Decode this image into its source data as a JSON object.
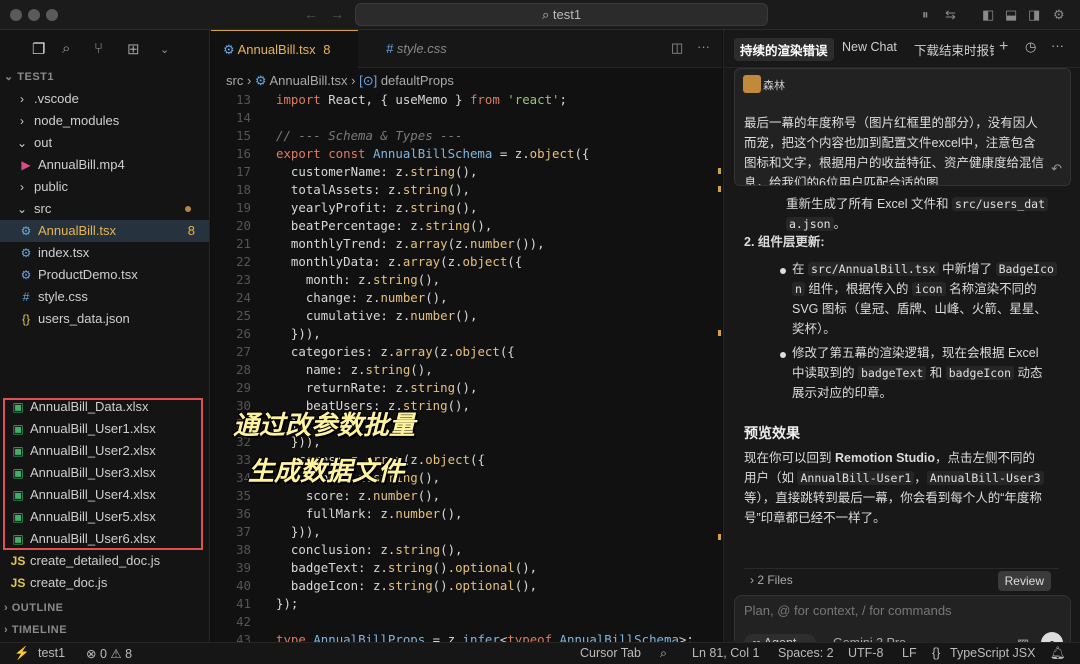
{
  "window": {
    "title": "test1"
  },
  "titlebar_icons": [
    "sidebar-left-icon",
    "panel-bottom-icon",
    "sidebar-right-icon",
    "gear-icon",
    "account-icon"
  ],
  "sidebar": {
    "root": "TEST1",
    "items": [
      {
        "label": ".vscode",
        "icon": "chevron-right"
      },
      {
        "label": "node_modules",
        "icon": "chevron-right"
      },
      {
        "label": "out",
        "icon": "chevron-down"
      },
      {
        "label": "AnnualBill.mp4",
        "icon": "video"
      },
      {
        "label": "public",
        "icon": "chevron-right"
      },
      {
        "label": "src",
        "icon": "chevron-down"
      },
      {
        "label": "AnnualBill.tsx",
        "icon": "gear",
        "badge": "8"
      },
      {
        "label": "index.tsx",
        "icon": "gear"
      },
      {
        "label": "ProductDemo.tsx",
        "icon": "gear"
      },
      {
        "label": "style.css",
        "icon": "hash"
      },
      {
        "label": "users_data.json",
        "icon": "braces"
      }
    ],
    "xlsx_files": [
      "AnnualBill_Data.xlsx",
      "AnnualBill_User1.xlsx",
      "AnnualBill_User2.xlsx",
      "AnnualBill_User3.xlsx",
      "AnnualBill_User4.xlsx",
      "AnnualBill_User5.xlsx",
      "AnnualBill_User6.xlsx"
    ],
    "js_files": [
      "create_detailed_doc.js",
      "create_doc.js"
    ],
    "outline": "OUTLINE",
    "timeline": "TIMELINE"
  },
  "editor": {
    "tabs": [
      {
        "label": "AnnualBill.tsx",
        "badge": "8"
      },
      {
        "label": "style.css"
      }
    ],
    "breadcrumb": {
      "folder": "src",
      "file": "AnnualBill.tsx",
      "symbol": "defaultProps"
    },
    "overlay_line1": "通过改参数批量",
    "overlay_line2": "生成数据文件"
  },
  "chat": {
    "tabs": [
      "持续的渲染错误",
      "New Chat",
      "下载结束时报错"
    ],
    "user_name": "森林",
    "user_message": "最后一幕的年度称号（图片红框里的部分），没有因人而宠，把这个内容也加到配置文件excel中，注意包含图标和文字，根据用户的收益特征、资产健康度给混信息，给我们的6位用户匹配合适的图",
    "partial_line_a": "重新生成了所有 Excel 文件和 ",
    "partial_code_a": "src/users_dat",
    "partial_code_a2": "a.json",
    "partial_line_a_end": "。",
    "section2_title": "2. 组件层更新:",
    "bullet1_pre": "在 ",
    "bullet1_code1": "src/AnnualBill.tsx",
    "bullet1_mid": " 中新增了 ",
    "bullet1_code2": "BadgeIco",
    "bullet1_code2b": "n",
    "bullet1_rest1": " 组件，根据传入的 ",
    "bullet1_code3": "icon",
    "bullet1_rest2": " 名称渲染不同的",
    "bullet1_rest3": "SVG 图标（皇冠、盾牌、山峰、火箭、星星、",
    "bullet1_rest4": "奖杯）。",
    "bullet2_line1": "修改了第五幕的渲染逻辑，现在会根据 Excel",
    "bullet2_pre": "中读取到的 ",
    "bullet2_code1": "badgeText",
    "bullet2_and": " 和 ",
    "bullet2_code2": "badgeIcon",
    "bullet2_end": " 动态",
    "bullet2_line3": "展示对应的印章。",
    "preview_title": "预览效果",
    "preview_p1": "现在你可以回到 ",
    "preview_bold": "Remotion Studio",
    "preview_p1b": "，点击左侧不同的",
    "preview_p2a": "用户（如 ",
    "preview_code1": "AnnualBill-User1",
    "preview_comma": "，",
    "preview_code2": "AnnualBill-User3",
    "preview_p3": "等），直接跳转到最后一幕，你会看到每个人的“年度称",
    "preview_p4": "号”印章都已经不一样了。",
    "files_label": "2 Files",
    "review_label": "Review",
    "input_placeholder": "Plan, @ for context, / for commands",
    "agent_label": "Agent",
    "model_label": "Gemini 3 Pro"
  },
  "status": {
    "branch": "test1",
    "errors": "0",
    "warnings": "8",
    "cursor_tab": "Cursor Tab",
    "position": "Ln 81, Col 1",
    "spaces": "Spaces: 2",
    "encoding": "UTF-8",
    "eol": "LF",
    "language": "TypeScript JSX"
  }
}
